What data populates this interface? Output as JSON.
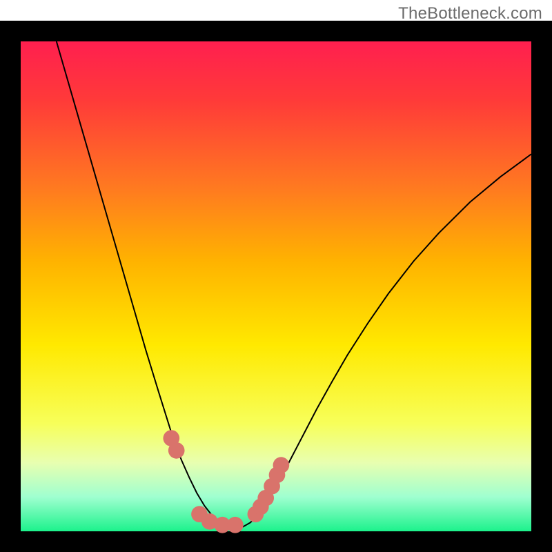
{
  "watermark": "TheBottleneck.com",
  "frame": {
    "outer_x": 0,
    "outer_y": 30,
    "outer_size": 800,
    "inner_margin": 30,
    "border_color": "#000000"
  },
  "gradient_stops": [
    {
      "offset": 0.0,
      "color": "#ff1f4f"
    },
    {
      "offset": 0.12,
      "color": "#ff3a39"
    },
    {
      "offset": 0.3,
      "color": "#ff7a20"
    },
    {
      "offset": 0.45,
      "color": "#ffb300"
    },
    {
      "offset": 0.62,
      "color": "#ffe900"
    },
    {
      "offset": 0.78,
      "color": "#f7ff5a"
    },
    {
      "offset": 0.86,
      "color": "#e8ffb0"
    },
    {
      "offset": 0.93,
      "color": "#9fffd0"
    },
    {
      "offset": 1.0,
      "color": "#1cf28c"
    }
  ],
  "chart_data": {
    "type": "line",
    "title": "",
    "xlabel": "",
    "ylabel": "",
    "xlim": [
      0,
      1
    ],
    "ylim": [
      0,
      1
    ],
    "series": [
      {
        "name": "curve",
        "stroke": "#000000",
        "stroke_width": 2,
        "x": [
          0.07,
          0.095,
          0.12,
          0.145,
          0.17,
          0.195,
          0.22,
          0.245,
          0.27,
          0.285,
          0.3,
          0.315,
          0.33,
          0.345,
          0.36,
          0.375,
          0.39,
          0.405,
          0.42,
          0.435,
          0.45,
          0.47,
          0.49,
          0.51,
          0.53,
          0.555,
          0.58,
          0.61,
          0.64,
          0.68,
          0.72,
          0.77,
          0.82,
          0.88,
          0.94,
          1.0
        ],
        "y": [
          1.0,
          0.91,
          0.82,
          0.73,
          0.64,
          0.55,
          0.46,
          0.37,
          0.285,
          0.235,
          0.185,
          0.145,
          0.11,
          0.078,
          0.052,
          0.032,
          0.018,
          0.009,
          0.004,
          0.009,
          0.018,
          0.04,
          0.072,
          0.11,
          0.15,
          0.2,
          0.25,
          0.306,
          0.36,
          0.425,
          0.485,
          0.552,
          0.61,
          0.672,
          0.724,
          0.77
        ]
      }
    ],
    "markers": {
      "color": "#d9736b",
      "radius_rel": 0.016,
      "points": [
        {
          "x": 0.295,
          "y": 0.19
        },
        {
          "x": 0.305,
          "y": 0.165
        },
        {
          "x": 0.35,
          "y": 0.035
        },
        {
          "x": 0.37,
          "y": 0.02
        },
        {
          "x": 0.395,
          "y": 0.013
        },
        {
          "x": 0.42,
          "y": 0.013
        },
        {
          "x": 0.46,
          "y": 0.035
        },
        {
          "x": 0.47,
          "y": 0.05
        },
        {
          "x": 0.48,
          "y": 0.068
        },
        {
          "x": 0.492,
          "y": 0.092
        },
        {
          "x": 0.502,
          "y": 0.115
        },
        {
          "x": 0.51,
          "y": 0.135
        }
      ]
    }
  }
}
